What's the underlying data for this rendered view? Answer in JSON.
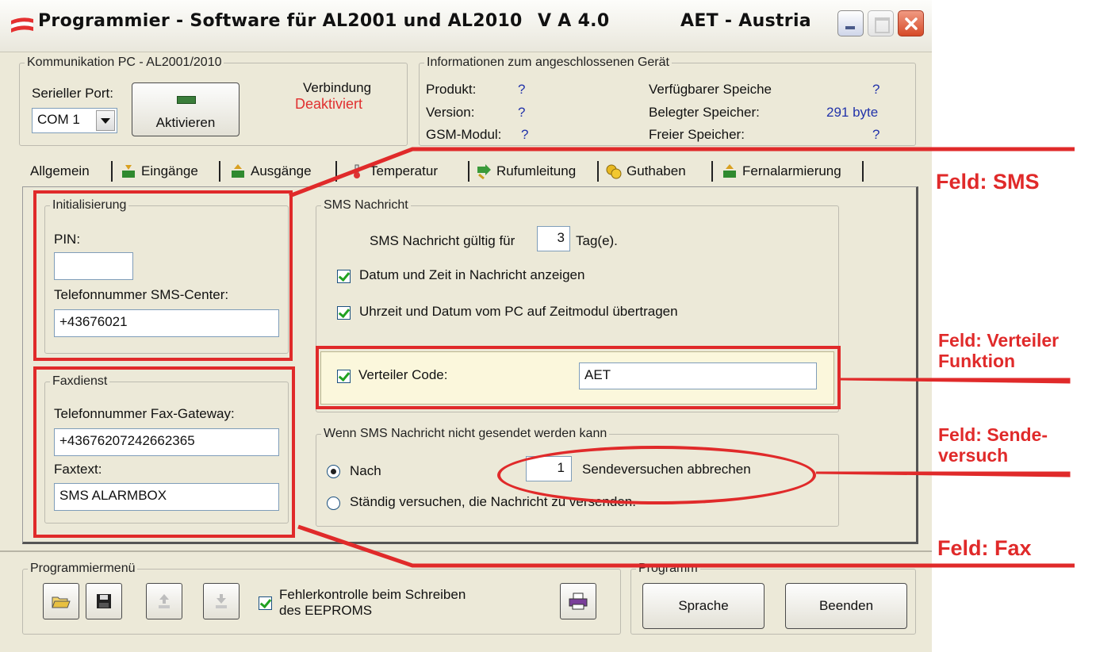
{
  "window": {
    "title": "Programmier - Software für AL2001 und AL2010",
    "version": "V A 4.0",
    "vendor": "AET - Austria"
  },
  "communication": {
    "legend": "Kommunikation PC - AL2001/2010",
    "port_label": "Serieller Port:",
    "port_value": "COM 1",
    "activate_button": "Aktivieren",
    "connection_label": "Verbindung",
    "connection_status": "Deaktiviert"
  },
  "device_info": {
    "legend": "Informationen zum angeschlossenen Gerät",
    "product_label": "Produkt:",
    "product_value": "?",
    "version_label": "Version:",
    "version_value": "?",
    "gsm_label": "GSM-Modul:",
    "gsm_value": "?",
    "available_label": "Verfügbarer Speiche",
    "available_value": "?",
    "used_label": "Belegter Speicher:",
    "used_value": "291 byte",
    "free_label": "Freier Speicher:",
    "free_value": "?"
  },
  "tabs": [
    {
      "label": "Allgemein"
    },
    {
      "label": "Eingänge"
    },
    {
      "label": "Ausgänge"
    },
    {
      "label": "Temperatur"
    },
    {
      "label": "Rufumleitung"
    },
    {
      "label": "Guthaben"
    },
    {
      "label": "Fernalarmierung"
    }
  ],
  "init": {
    "legend": "Initialisierung",
    "pin_label": "PIN:",
    "pin_value": "",
    "smsc_label": "Telefonnummer SMS-Center:",
    "smsc_value": "+43676021"
  },
  "fax": {
    "legend": "Faxdienst",
    "gateway_label": "Telefonnummer Fax-Gateway:",
    "gateway_value": "+43676207242662365",
    "text_label": "Faxtext:",
    "text_value": "SMS ALARMBOX"
  },
  "sms": {
    "legend": "SMS Nachricht",
    "valid_prefix": "SMS Nachricht gültig für",
    "valid_days": "3",
    "valid_suffix": "Tag(e).",
    "show_datetime": "Datum und Zeit in Nachricht anzeigen",
    "transfer_time": "Uhrzeit und Datum vom PC auf Zeitmodul übertragen",
    "distributor_label": "Verteiler Code:",
    "distributor_value": "AET"
  },
  "retry": {
    "legend": "Wenn SMS Nachricht nicht gesendet werden kann",
    "after_label": "Nach",
    "attempts": "1",
    "attempts_suffix": "Sendeversuchen abbrechen",
    "continuous_label": "Ständig versuchen, die Nachricht zu versenden."
  },
  "program_menu": {
    "legend": "Programmiermenü",
    "error_check_line1": "Fehlerkontrolle beim Schreiben",
    "error_check_line2": "des EEPROMS"
  },
  "program": {
    "legend": "Programm",
    "language_button": "Sprache",
    "exit_button": "Beenden"
  },
  "annotations": {
    "sms": "Feld: SMS",
    "distributor_1": "Feld: Verteiler",
    "distributor_2": "Funktion",
    "retry_1": "Feld: Sende-",
    "retry_2": "versuch",
    "fax": "Feld: Fax"
  },
  "colors": {
    "annotation_red": "#e02a2a",
    "status_red": "#e03030",
    "value_blue": "#2233aa",
    "window_bg": "#ece9d8"
  }
}
